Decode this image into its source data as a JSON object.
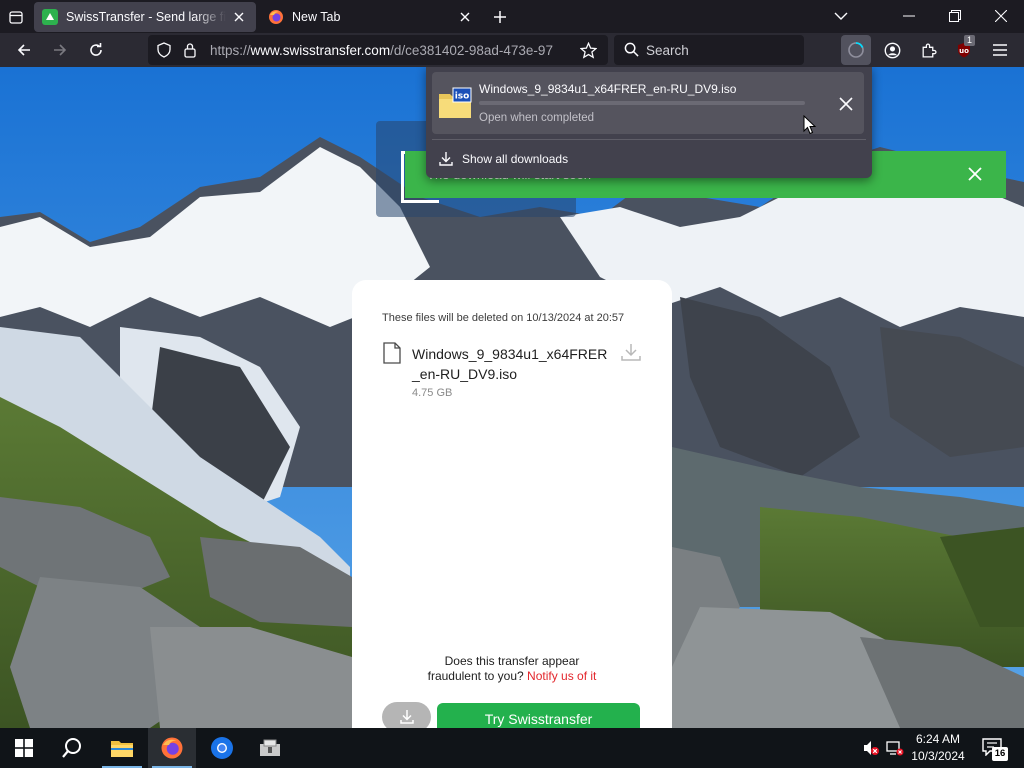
{
  "browser": {
    "tabs": [
      {
        "title": "SwissTransfer - Send large files securely",
        "active": true
      },
      {
        "title": "New Tab",
        "active": false
      }
    ],
    "url": {
      "scheme": "https://",
      "host": "www.swisstransfer.com",
      "path": "/d/ce381402-98ad-473e-97"
    },
    "search_placeholder": "Search",
    "downloads_badge": "1"
  },
  "downloads_panel": {
    "item": {
      "filename": "Windows_9_9834u1_x64FRER_en-RU_DV9.iso",
      "icon_text": "iso",
      "status": "Open when completed",
      "progress": 0.0
    },
    "show_all_label": "Show all downloads"
  },
  "page": {
    "banner_text": "The download will start soon",
    "deleted_note": "These files will be deleted on 10/13/2024 at 20:57",
    "file": {
      "name": "Windows_9_9834u1_x64FRER_en-RU_DV9.iso",
      "size": "4.75 GB"
    },
    "fraud_question_line1": "Does this transfer appear",
    "fraud_question_line2": "fraudulent to you?",
    "notify_link": "Notify us of it",
    "try_button": "Try Swisstransfer"
  },
  "taskbar": {
    "time": "6:24 AM",
    "date": "10/3/2024",
    "notification_count": "16"
  },
  "colors": {
    "accent_green": "#23b14d",
    "banner_green": "#3bb54a",
    "notify_red": "#e3262c",
    "progress_cyan": "#00ddff"
  }
}
